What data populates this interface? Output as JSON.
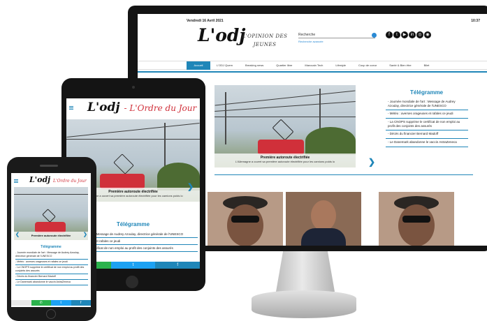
{
  "colors": {
    "accent": "#1f86b8",
    "green": "#2bb24c",
    "twitter": "#1da1f2",
    "facebook": "#1f86b8"
  },
  "desktop": {
    "date": "Vendredi 16 Avril 2021",
    "time": "10:37",
    "logo": "L'odj",
    "tagline": "L'OPINION DES JEUNES",
    "search_placeholder": "Recherche",
    "advanced_search": "Recherche avancée",
    "social_icons": [
      "facebook-icon",
      "twitter-icon",
      "youtube-icon",
      "linkedin-icon",
      "instagram-icon",
      "podcast-icon"
    ],
    "nav": [
      "Accueil",
      "L'ODJ Quem",
      "Breaking news",
      "Quartier libre",
      "Marocain Tech",
      "Lifestyle",
      "Coup de coeur",
      "Santé & Bien être",
      "Bilet"
    ],
    "slide_title": "Première autoroute électrifiée",
    "slide_sub": "L'Allemagne a ouvert sa première autoroute électrifiée pour les camions poids lo",
    "telegram_title": "Télégramme",
    "telegram": [
      "- Journée mondiale de l'art : Message de Audrey Azoulay, directrice générale de l'UNESCO",
      "- Météo : averses orageuses et rafales ce jeudi",
      "- La CNOPS supprime le certificat de non emploi au profit des conjoints des assurés",
      "- Décès du financier Bernard Madoff",
      "- Le Danemark abandonne le vaccin AstraZeneca"
    ]
  },
  "tablet": {
    "logo": "L'odj",
    "logo_suffix": "- L'Ordre du Jour",
    "slide_title": "Première autoroute électrifiée",
    "slide_sub": "L'Allemagne a ouvert sa première autoroute électrifiée pour les camions poids lo",
    "telegram_title": "Télégramme",
    "telegram": [
      "rt : Message de Audrey Azoulay, directrice générale de l'UNESCO",
      "es et rafales ce jeudi",
      "certificat de non emploi au profit des conjoints des assurés"
    ]
  },
  "phone": {
    "logo": "L'odj",
    "logo_suffix": "L'Ordre du Jour",
    "slide_title": "Première autoroute électrifiée",
    "telegram_title": "Télégramme",
    "telegram": [
      "- Journée mondiale de l'art : Message de Audrey Azoulay, directrice générale de l'UNESCO",
      "- Météo : averses orageuses et rafales ce jeudi",
      "- La CNOPS supprime le certificat de non emploi au profit des conjoints des assurés",
      "- Décès du financier Bernard Madoff",
      "- Le Danemark abandonne le vaccin AstraZeneca"
    ]
  }
}
